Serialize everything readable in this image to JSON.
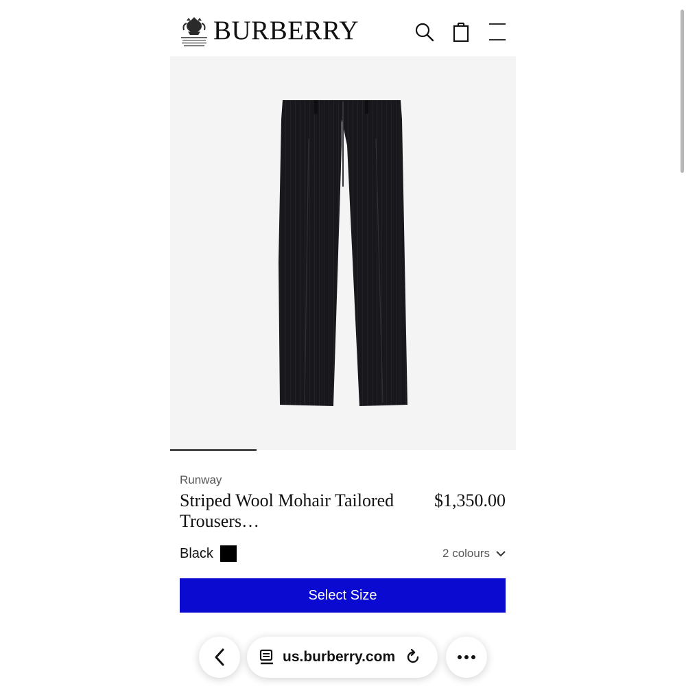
{
  "header": {
    "brand": "BURBERRY",
    "crest_caption": "BY APPOINTMENT TO HIS MAJESTY KING CHARLES III OUTFITTERS BURBERRY LIMITED LONDON",
    "icons": [
      "search-icon",
      "shopping-bag-icon",
      "menu-icon"
    ]
  },
  "product": {
    "collection": "Runway",
    "name": "Striped Wool Mohair Tailored Trousers…",
    "price": "$1,350.00",
    "colour": "Black",
    "colour_hex": "#000000",
    "colours_count": "2 colours",
    "cta": "Select Size",
    "cta_color": "#0a0ad1",
    "image_alt": "black-tailored-trousers"
  },
  "browser": {
    "url": "us.burberry.com",
    "icons": [
      "back-chevron-icon",
      "reader-icon",
      "reload-icon",
      "more-icon"
    ]
  }
}
